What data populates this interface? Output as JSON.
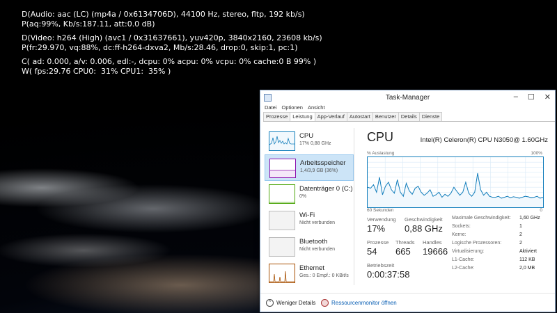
{
  "overlay": {
    "lines": [
      "D(Audio: aac (LC) (mp4a / 0x6134706D), 44100 Hz, stereo, fltp, 192 kb/s)",
      "P(aq:99%, Kb/s:187.11, att:0.0 dB)",
      "D(Video: h264 (High) (avc1 / 0x31637661), yuv420p, 3840x2160, 23608 kb/s)",
      "P(fr:29.970, vq:88%, dc:ff-h264-dxva2, Mb/s:28.46, drop:0, skip:1, pc:1)",
      "C( ad: 0.000, a/v: 0.006, edl:-, dcpu: 0% acpu: 0% vcpu: 0% cache:0 B 99% )",
      "W( fps:29.76 CPU0:  31% CPU1:  35% )"
    ]
  },
  "taskmanager": {
    "title": "Task-Manager",
    "window_buttons": [
      "–",
      "☐",
      "✕"
    ],
    "menu": [
      "Datei",
      "Optionen",
      "Ansicht"
    ],
    "tabs": [
      "Prozesse",
      "Leistung",
      "App-Verlauf",
      "Autostart",
      "Benutzer",
      "Details",
      "Dienste"
    ],
    "active_tab": "Leistung",
    "resources": [
      {
        "name": "CPU",
        "sub": "17% 0,88 GHz",
        "color": "#117dbb"
      },
      {
        "name": "Arbeitsspeicher",
        "sub": "1,4/3,9 GB (36%)",
        "color": "#8b12ae"
      },
      {
        "name": "Datenträger 0 (C:)",
        "sub": "0%",
        "color": "#4da60c"
      },
      {
        "name": "Wi-Fi",
        "sub": "Nicht verbunden",
        "color": "#a0a0a0"
      },
      {
        "name": "Bluetooth",
        "sub": "Nicht verbunden",
        "color": "#a0a0a0"
      },
      {
        "name": "Ethernet",
        "sub": "Ges.: 0  Empf.: 0 KBit/s",
        "color": "#a74f01"
      }
    ],
    "cpu": {
      "title": "CPU",
      "model": "Intel(R) Celeron(R) CPU N3050@ 1.60GHz",
      "graph_label_left": "% Auslastung",
      "graph_label_right": "100%",
      "graph_footer_left": "60 Sekunden",
      "graph_footer_right": "0",
      "utilization_series": [
        40,
        38,
        45,
        30,
        60,
        25,
        42,
        50,
        35,
        28,
        55,
        30,
        22,
        48,
        33,
        26,
        38,
        42,
        30,
        24,
        28,
        35,
        22,
        25,
        30,
        20,
        26,
        22,
        28,
        40,
        32,
        24,
        30,
        50,
        28,
        22,
        30,
        68,
        35,
        24,
        30,
        22,
        20,
        20,
        22,
        18,
        20,
        22,
        19,
        21,
        20,
        18,
        20,
        22,
        21,
        19,
        20,
        22,
        18,
        20
      ],
      "stats": {
        "usage_label": "Verwendung",
        "usage": "17%",
        "speed_label": "Geschwindigkeit",
        "speed": "0,88 GHz",
        "processes_label": "Prozesse",
        "processes": "54",
        "threads_label": "Threads",
        "threads": "665",
        "handles_label": "Handles",
        "handles": "19666",
        "uptime_label": "Betriebszeit",
        "uptime": "0:00:37:58"
      },
      "specs": [
        {
          "label": "Maximale Geschwindigkeit:",
          "value": "1,60 GHz"
        },
        {
          "label": "Sockets:",
          "value": "1"
        },
        {
          "label": "Kerne:",
          "value": "2"
        },
        {
          "label": "Logische Prozessoren:",
          "value": "2"
        },
        {
          "label": "Virtualisierung:",
          "value": "Aktiviert"
        },
        {
          "label": "L1-Cache:",
          "value": "112 KB"
        },
        {
          "label": "L2-Cache:",
          "value": "2,0 MB"
        }
      ]
    },
    "footer": {
      "fewer_details": "Weniger Details",
      "resource_monitor": "Ressourcenmonitor öffnen"
    }
  }
}
